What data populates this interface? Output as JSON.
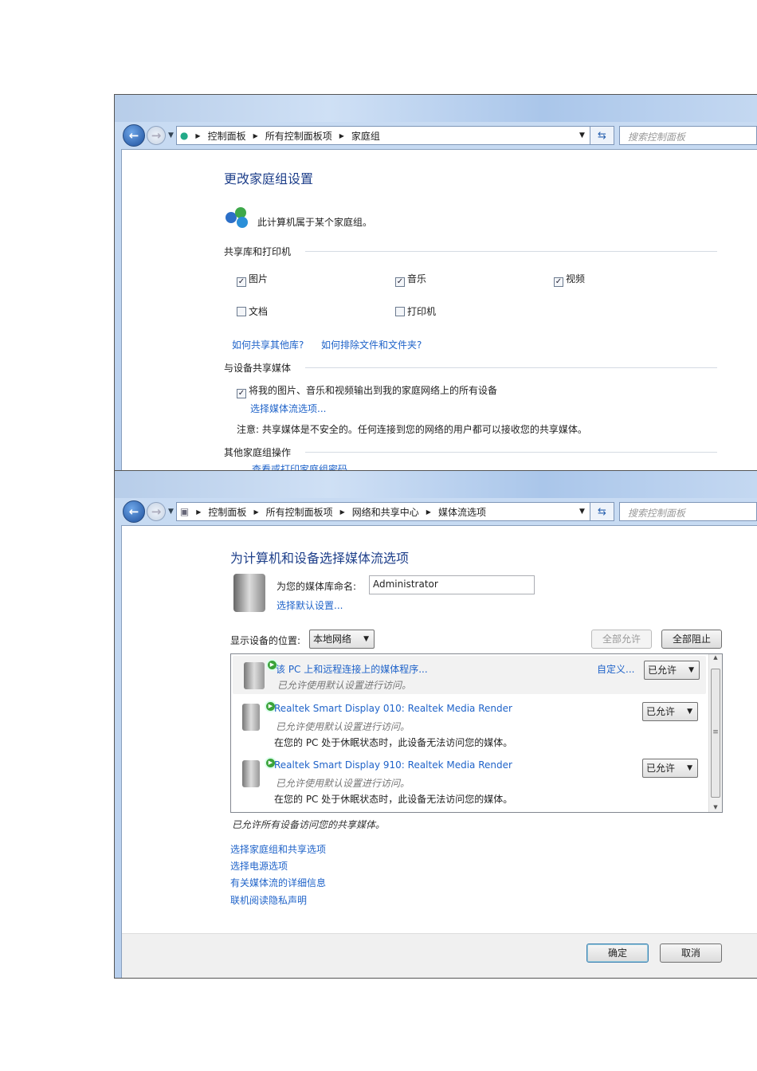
{
  "window1": {
    "breadcrumb": [
      "控制面板",
      "所有控制面板项",
      "家庭组"
    ],
    "search_placeholder": "搜索控制面板",
    "title": "更改家庭组设置",
    "status": "此计算机属于某个家庭组。",
    "section_libraries": "共享库和打印机",
    "libraries": [
      {
        "label": "图片",
        "checked": true
      },
      {
        "label": "音乐",
        "checked": true
      },
      {
        "label": "视频",
        "checked": true
      },
      {
        "label": "文档",
        "checked": false
      },
      {
        "label": "打印机",
        "checked": false
      }
    ],
    "link_share_other": "如何共享其他库?",
    "link_exclude": "如何排除文件和文件夹?",
    "section_media": "与设备共享媒体",
    "media_checkbox": "将我的图片、音乐和视频输出到我的家庭网络上的所有设备",
    "media_link": "选择媒体流选项...",
    "media_note": "注意: 共享媒体是不安全的。任何连接到您的网络的用户都可以接收您的共享媒体。",
    "section_other": "其他家庭组操作",
    "link_password": "查看或打印家庭组密码"
  },
  "window2": {
    "breadcrumb": [
      "控制面板",
      "所有控制面板项",
      "网络和共享中心",
      "媒体流选项"
    ],
    "search_placeholder": "搜索控制面板",
    "title": "为计算机和设备选择媒体流选项",
    "name_label": "为您的媒体库命名:",
    "name_value": "Administrator",
    "default_link": "选择默认设置...",
    "location_label": "显示设备的位置:",
    "location_value": "本地网络",
    "allow_all": "全部允许",
    "block_all": "全部阻止",
    "devices": [
      {
        "name": "该 PC 上和远程连接上的媒体程序...",
        "status": "已允许使用默认设置进行访问。",
        "custom": "自定义...",
        "access": "已允许"
      },
      {
        "name": "Realtek Smart Display 010: Realtek Media Render",
        "status": "已允许使用默认设置进行访问。",
        "note": "在您的 PC 处于休眠状态时，此设备无法访问您的媒体。",
        "access": "已允许"
      },
      {
        "name": "Realtek Smart Display 910: Realtek Media Render",
        "status": "已允许使用默认设置进行访问。",
        "note": "在您的 PC 处于休眠状态时，此设备无法访问您的媒体。",
        "access": "已允许"
      }
    ],
    "summary": "已允许所有设备访问您的共享媒体。",
    "links": [
      "选择家庭组和共享选项",
      "选择电源选项",
      "有关媒体流的详细信息",
      "联机阅读隐私声明"
    ],
    "ok": "确定",
    "cancel": "取消"
  }
}
